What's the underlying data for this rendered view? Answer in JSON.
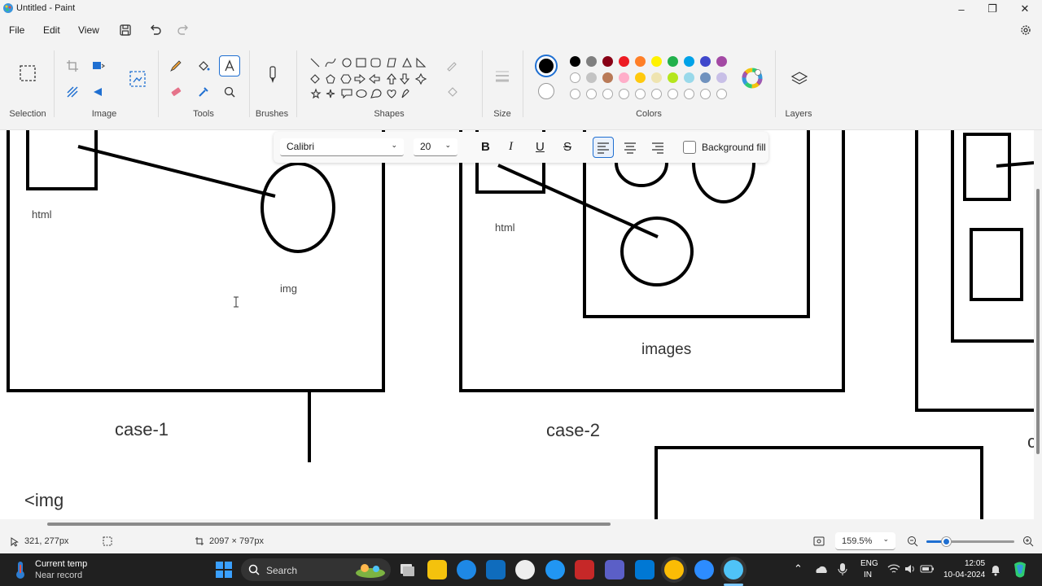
{
  "window": {
    "title": "Untitled - Paint",
    "minimize": "–",
    "maximize": "❐",
    "close": "✕"
  },
  "menu": {
    "file": "File",
    "edit": "Edit",
    "view": "View"
  },
  "ribbon": {
    "groups": {
      "selection": "Selection",
      "image": "Image",
      "tools": "Tools",
      "brushes": "Brushes",
      "shapes": "Shapes",
      "size": "Size",
      "colors": "Colors",
      "layers": "Layers"
    },
    "palette_row1": [
      "#000000",
      "#7f7f7f",
      "#880015",
      "#ed1c24",
      "#ff7f27",
      "#fff200",
      "#22b14c",
      "#00a2e8",
      "#3f48cc",
      "#a349a4"
    ],
    "palette_row2": [
      "#ffffff",
      "#c3c3c3",
      "#b97a57",
      "#ffaec9",
      "#ffc90e",
      "#efe4b0",
      "#b5e61d",
      "#99d9ea",
      "#7092be",
      "#c8bfe7"
    ],
    "primary_color": "#000000",
    "secondary_color": "#ffffff"
  },
  "text_toolbar": {
    "font": "Calibri",
    "size": "20",
    "bold": "B",
    "italic": "I",
    "underline": "U",
    "strike": "S",
    "background_fill": "Background fill"
  },
  "canvas": {
    "labels": {
      "html1": "html",
      "img1": "img",
      "case1": "case-1",
      "img_tag": "<img",
      "html2": "html",
      "images": "images",
      "case2": "case-2",
      "edge_c": "c"
    }
  },
  "status": {
    "cursor_pos": "321, 277px",
    "canvas_size": "2097 × 797px",
    "zoom": "159.5%",
    "zoom_level": 0.22
  },
  "taskbar": {
    "weather_title": "Current temp",
    "weather_sub": "Near record",
    "search_placeholder": "Search",
    "lang1": "ENG",
    "lang2": "IN",
    "time": "12:05",
    "date": "10-04-2024"
  }
}
